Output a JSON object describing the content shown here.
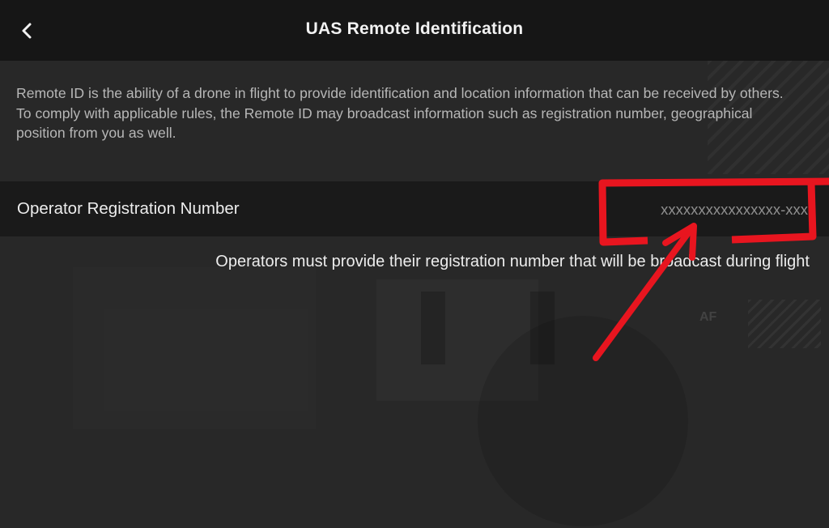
{
  "header": {
    "title": "UAS Remote Identification",
    "back_icon": "chevron-left-icon"
  },
  "description": "Remote ID is the ability of a drone in flight to provide identification and location information that can be received by others. To comply with applicable rules, the Remote ID may broadcast information such as registration number, geographical position from you as well.",
  "registration": {
    "label": "Operator Registration Number",
    "placeholder": "xxxxxxxxxxxxxxxx-xxx",
    "value": ""
  },
  "hint": "Operators must provide their registration number that will be broadcast during flight",
  "background": {
    "overlay_mark": "AF"
  },
  "annotation": {
    "color": "#e8151f",
    "shapes": [
      "highlight-box",
      "pointer-arrow"
    ]
  },
  "colors": {
    "header_bg": "#161616",
    "page_bg": "#282828",
    "row_bg": "#1a1a1a",
    "annotation_red": "#e8151f"
  }
}
